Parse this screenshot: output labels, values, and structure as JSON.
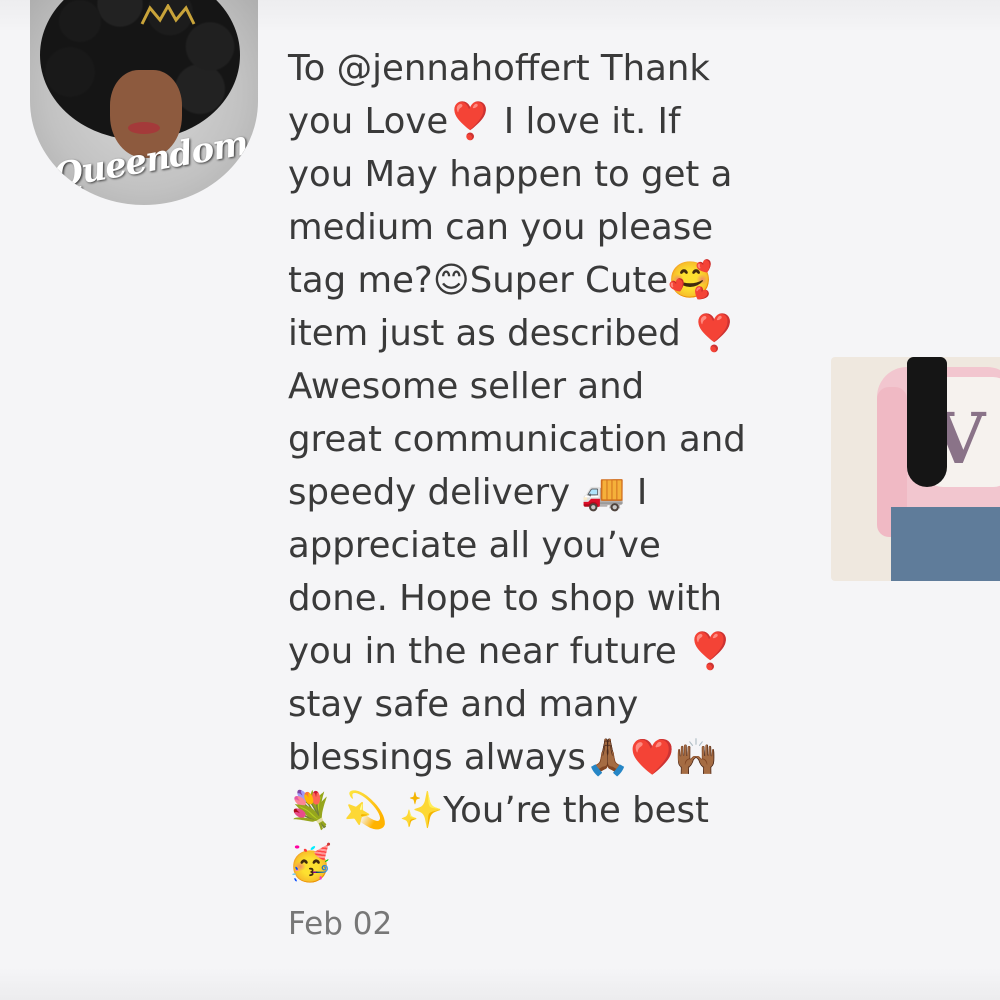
{
  "comment": {
    "lines": [
      "To @jennahoffert Thank",
      "you Love❣️ I love it. If",
      "you May happen to get a",
      "medium can you please",
      "tag me?😊Super Cute🥰",
      "item just as described ❣️",
      "Awesome seller and",
      "great communication and",
      "speedy delivery 🚚 I",
      "appreciate all you’ve",
      "done. Hope to shop with",
      "you in the near future ❣️",
      "stay safe and many",
      "blessings always🙏🏾❤️🙌🏾",
      "💐 💫 ✨You’re the best",
      "🥳"
    ],
    "date": "Feb 02"
  },
  "avatar": {
    "logo_text": "Queendom"
  },
  "colors": {
    "background": "#f5f5f7",
    "text": "#3a3a3a",
    "date": "#777777"
  }
}
